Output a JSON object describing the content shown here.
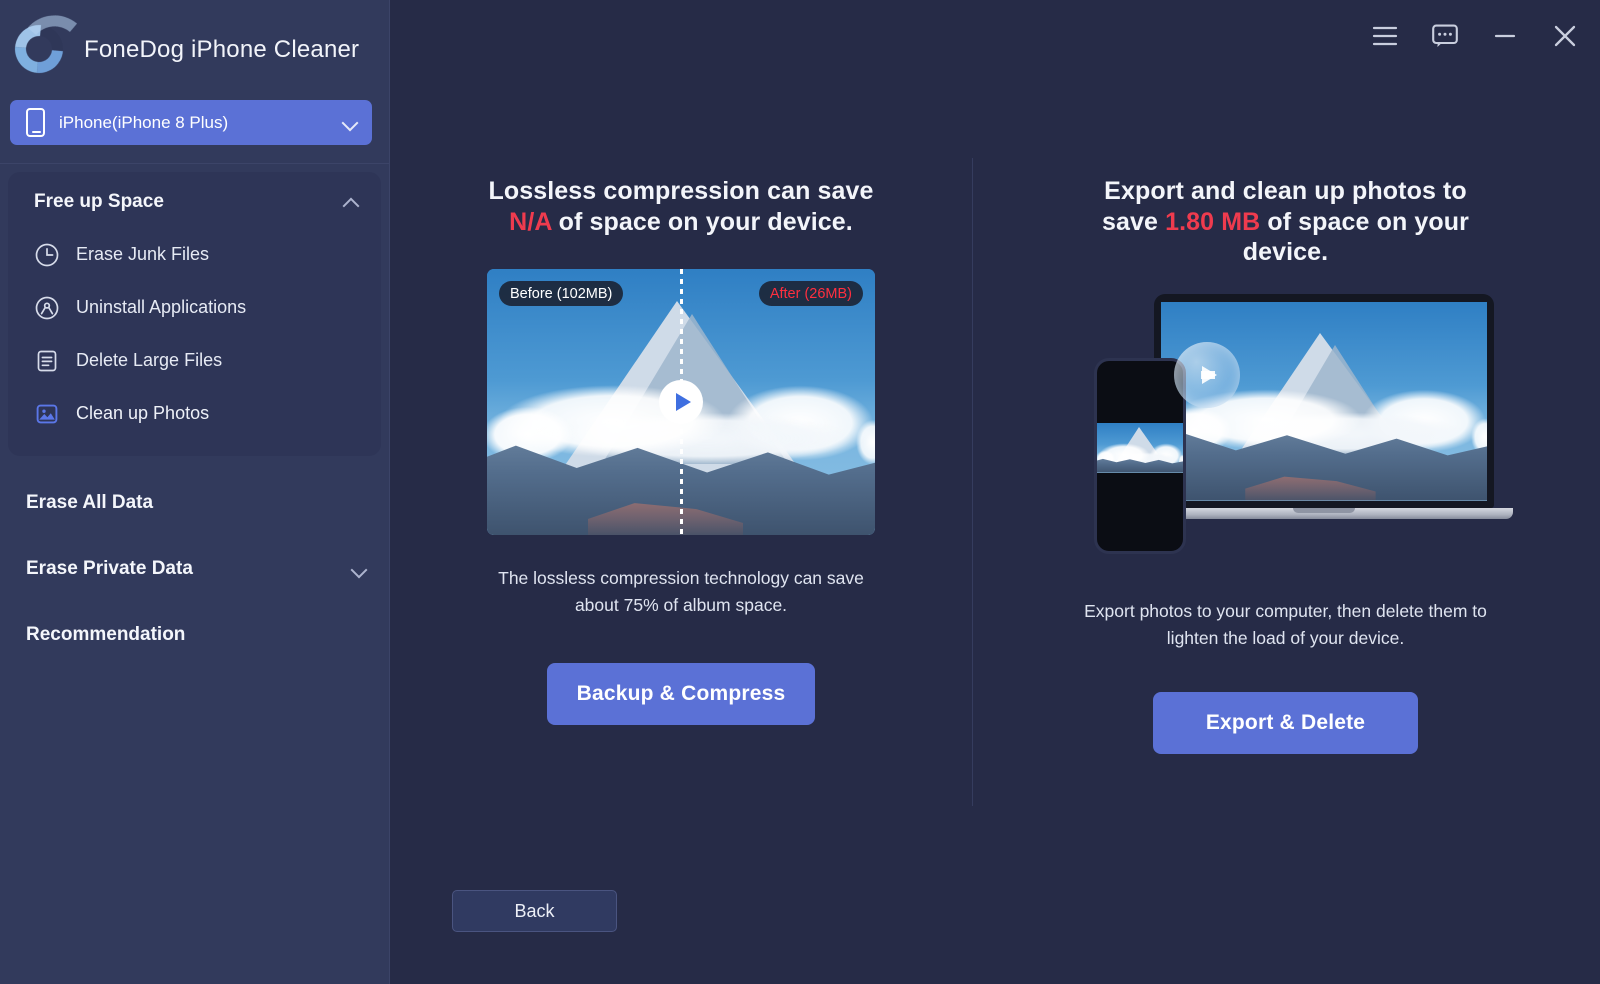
{
  "app": {
    "title": "FoneDog iPhone Cleaner",
    "logo_icon": "fonedog-c-logo"
  },
  "titlebar": {
    "buttons": [
      {
        "name": "menu-icon",
        "label": "Menu"
      },
      {
        "name": "feedback-icon",
        "label": "Feedback"
      },
      {
        "name": "minimize-icon",
        "label": "Minimize"
      },
      {
        "name": "close-icon",
        "label": "Close"
      }
    ]
  },
  "sidebar": {
    "device": {
      "icon": "phone-icon",
      "value": "iPhone(iPhone 8 Plus)",
      "chevron": "chevron-down-icon"
    },
    "groups": [
      {
        "label": "Free up Space",
        "expanded": true,
        "chevron": "chevron-up-icon",
        "items": [
          {
            "label": "Erase Junk Files",
            "icon": "clock-icon",
            "active": false
          },
          {
            "label": "Uninstall Applications",
            "icon": "app-uninstall-icon",
            "active": false
          },
          {
            "label": "Delete Large Files",
            "icon": "document-lines-icon",
            "active": false
          },
          {
            "label": "Clean up Photos",
            "icon": "photo-icon",
            "active": true
          }
        ]
      },
      {
        "label": "Erase All Data",
        "expanded": false,
        "chevron": "",
        "items": []
      },
      {
        "label": "Erase Private Data",
        "expanded": false,
        "chevron": "chevron-down-icon",
        "items": []
      },
      {
        "label": "Recommendation",
        "expanded": false,
        "chevron": "",
        "items": []
      }
    ]
  },
  "main": {
    "panels": [
      {
        "heading_pre": "Lossless compression can save ",
        "heading_highlight": "N/A",
        "heading_post": " of space on your device.",
        "media": {
          "type": "before-after-compare",
          "badge_before": "Before (102MB)",
          "badge_after": "After (26MB)",
          "play_icon": "play-icon"
        },
        "description": "The lossless compression technology can save about 75% of album space.",
        "cta": "Backup & Compress"
      },
      {
        "heading_pre": "Export and clean up photos to save ",
        "heading_highlight": "1.80 MB",
        "heading_post": " of space on your device.",
        "media": {
          "type": "phone-to-laptop-transfer",
          "transfer_icon": "arrow-right-icon"
        },
        "description": "Export photos to your computer, then delete them to lighten the load of your device.",
        "cta": "Export & Delete"
      }
    ],
    "back_label": "Back"
  },
  "colors": {
    "sidebar_bg": "#323a5c",
    "main_bg": "#262b47",
    "accent": "#5b71d6",
    "highlight_red": "#ef3b4e",
    "after_badge_red": "#ff2f3f"
  }
}
